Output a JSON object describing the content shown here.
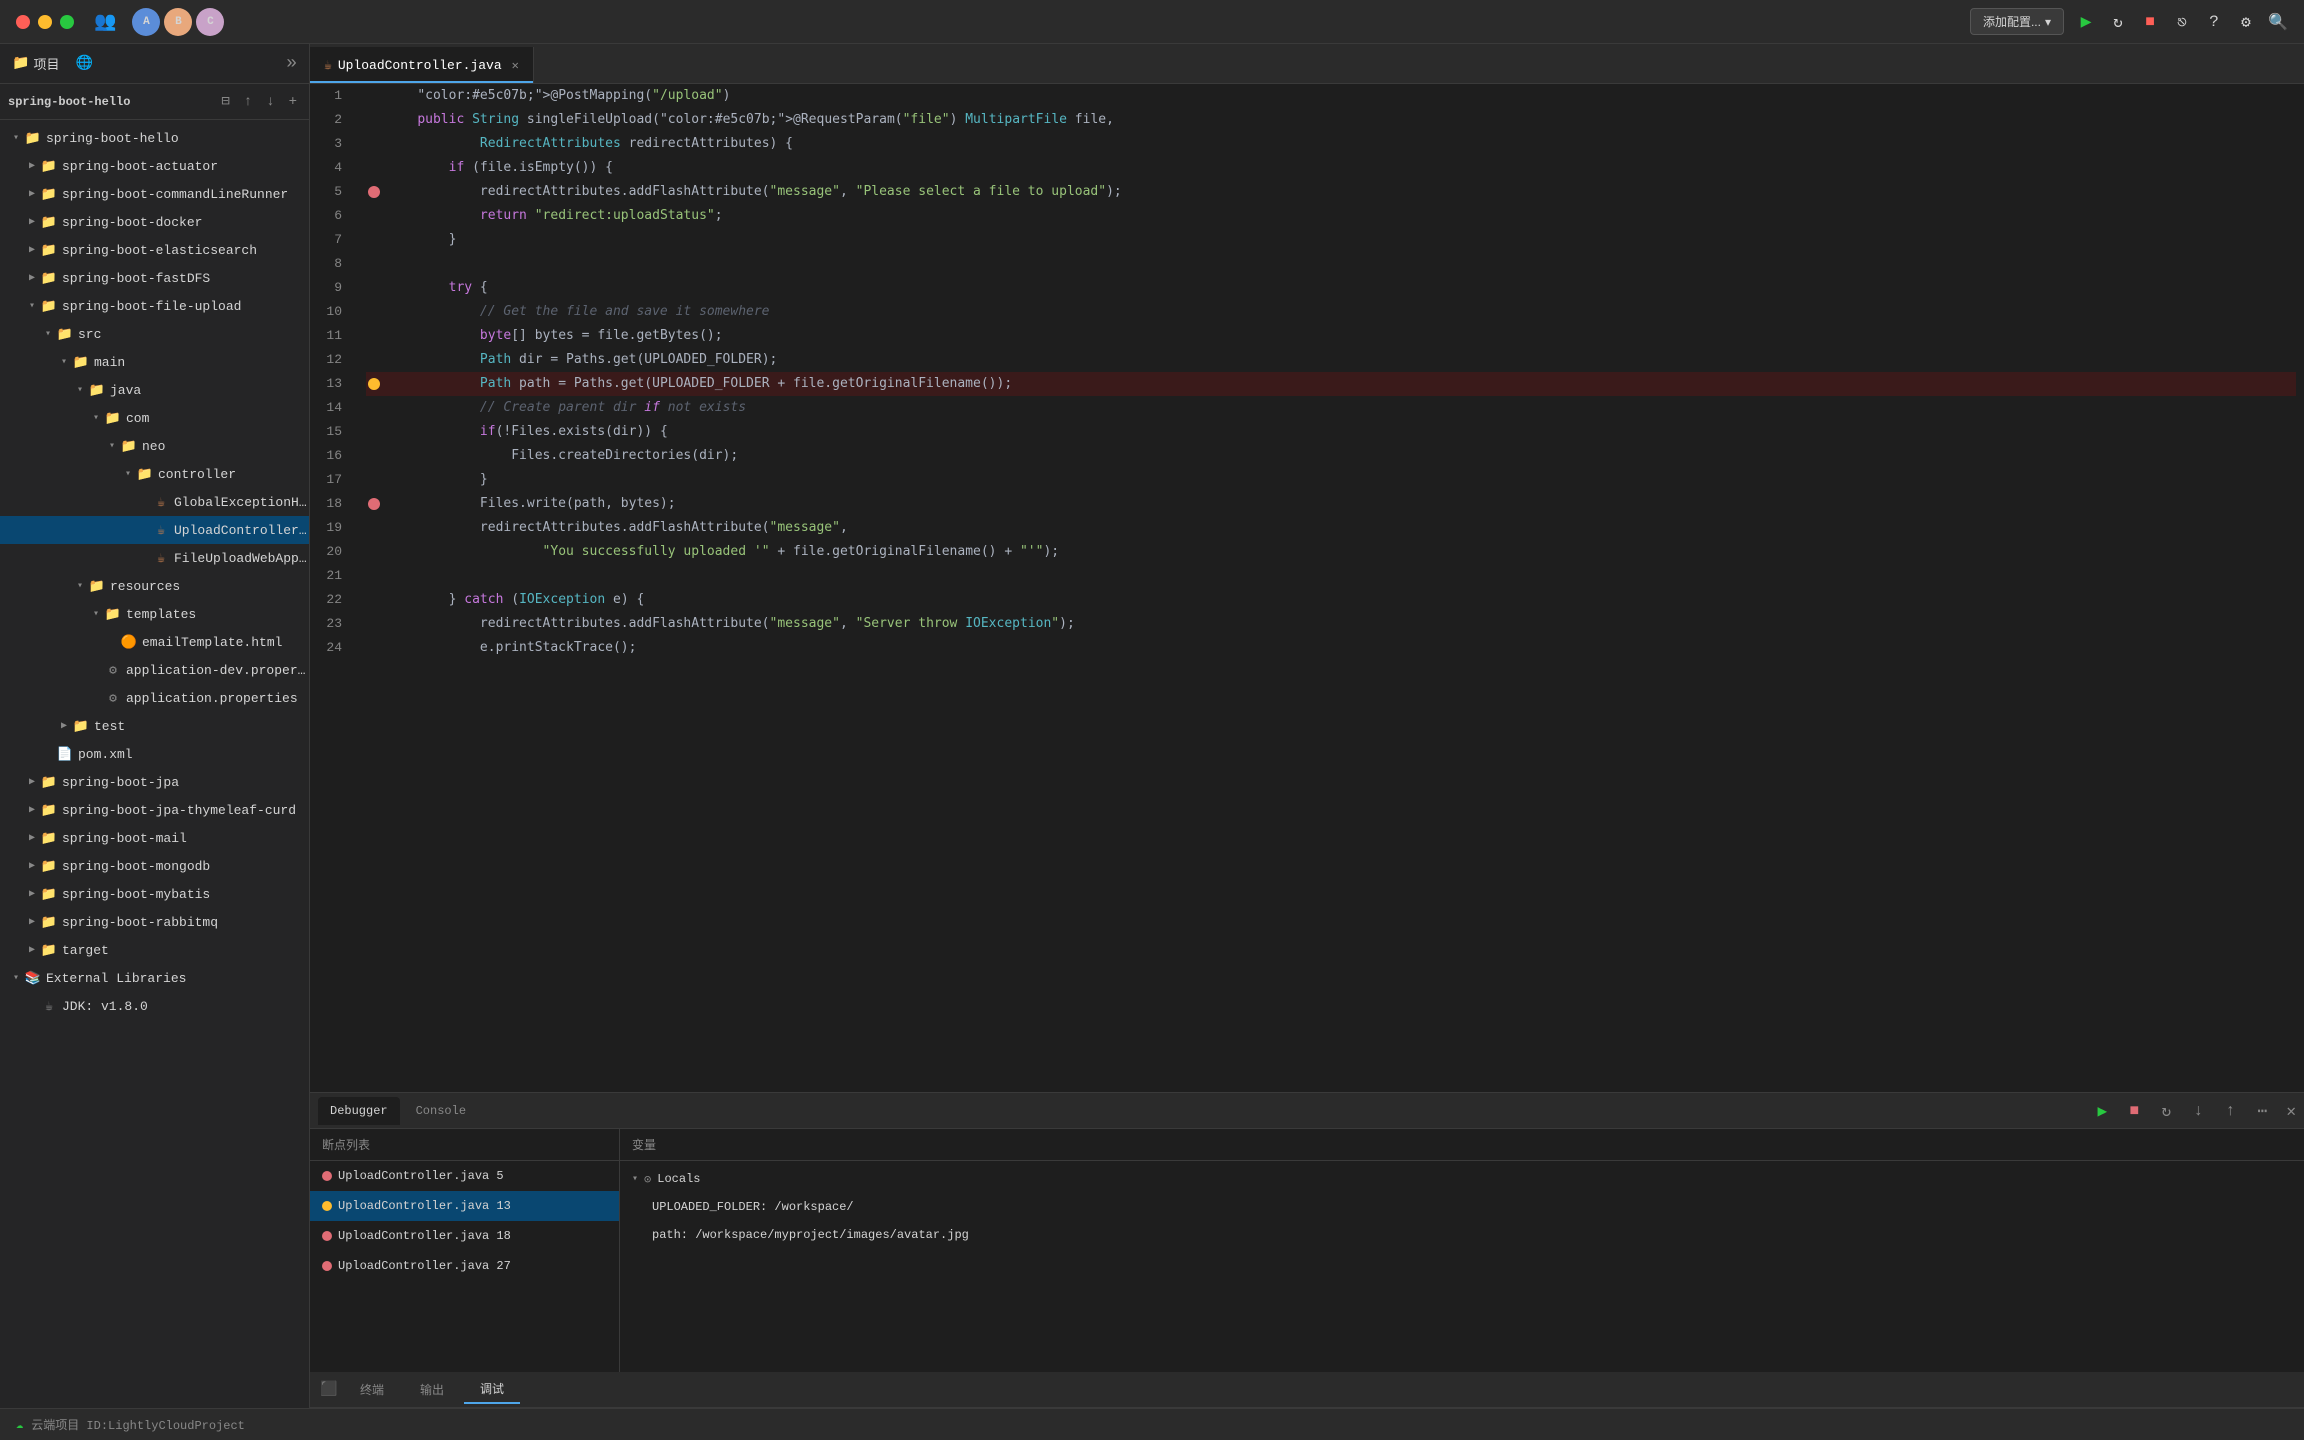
{
  "titlebar": {
    "add_config_label": "添加配置...",
    "chevron": "▾"
  },
  "sidebar": {
    "tabs": [
      {
        "label": "项目",
        "icon": "📁"
      },
      {
        "label": "🌐",
        "icon": "🌐"
      }
    ],
    "root": "spring-boot-hello",
    "tree": [
      {
        "id": "spring-boot-hello",
        "label": "spring-boot-hello",
        "indent": 8,
        "type": "root",
        "expanded": true,
        "arrow": "▾"
      },
      {
        "id": "spring-boot-actuator",
        "label": "spring-boot-actuator",
        "indent": 24,
        "type": "folder",
        "expanded": false,
        "arrow": "▶"
      },
      {
        "id": "spring-boot-commandLineRunner",
        "label": "spring-boot-commandLineRunner",
        "indent": 24,
        "type": "folder",
        "expanded": false,
        "arrow": "▶"
      },
      {
        "id": "spring-boot-docker",
        "label": "spring-boot-docker",
        "indent": 24,
        "type": "folder",
        "expanded": false,
        "arrow": "▶"
      },
      {
        "id": "spring-boot-elasticsearch",
        "label": "spring-boot-elasticsearch",
        "indent": 24,
        "type": "folder",
        "expanded": false,
        "arrow": "▶"
      },
      {
        "id": "spring-boot-fastDFS",
        "label": "spring-boot-fastDFS",
        "indent": 24,
        "type": "folder",
        "expanded": false,
        "arrow": "▶"
      },
      {
        "id": "spring-boot-file-upload",
        "label": "spring-boot-file-upload",
        "indent": 24,
        "type": "folder",
        "expanded": true,
        "arrow": "▾"
      },
      {
        "id": "src",
        "label": "src",
        "indent": 40,
        "type": "folder",
        "expanded": true,
        "arrow": "▾"
      },
      {
        "id": "main",
        "label": "main",
        "indent": 56,
        "type": "folder",
        "expanded": true,
        "arrow": "▾"
      },
      {
        "id": "java",
        "label": "java",
        "indent": 72,
        "type": "folder",
        "expanded": true,
        "arrow": "▾"
      },
      {
        "id": "com",
        "label": "com",
        "indent": 88,
        "type": "folder",
        "expanded": true,
        "arrow": "▾"
      },
      {
        "id": "neo",
        "label": "neo",
        "indent": 104,
        "type": "folder",
        "expanded": true,
        "arrow": "▾"
      },
      {
        "id": "controller",
        "label": "controller",
        "indent": 120,
        "type": "folder",
        "expanded": true,
        "arrow": "▾"
      },
      {
        "id": "GlobalExceptionHandler",
        "label": "GlobalExceptionHandler.ja...",
        "indent": 136,
        "type": "java",
        "expanded": false,
        "arrow": ""
      },
      {
        "id": "UploadController",
        "label": "UploadController.java",
        "indent": 136,
        "type": "java",
        "expanded": false,
        "arrow": "",
        "selected": true
      },
      {
        "id": "FileUploadWebApplication",
        "label": "FileUploadWebApplication.ja...",
        "indent": 136,
        "type": "java",
        "expanded": false,
        "arrow": ""
      },
      {
        "id": "resources",
        "label": "resources",
        "indent": 72,
        "type": "folder",
        "expanded": true,
        "arrow": "▾"
      },
      {
        "id": "templates",
        "label": "templates",
        "indent": 88,
        "type": "folder",
        "expanded": true,
        "arrow": "▾"
      },
      {
        "id": "emailTemplate",
        "label": "emailTemplate.html",
        "indent": 104,
        "type": "html",
        "expanded": false,
        "arrow": ""
      },
      {
        "id": "app-dev-props",
        "label": "application-dev.properties",
        "indent": 88,
        "type": "properties",
        "expanded": false,
        "arrow": ""
      },
      {
        "id": "app-props",
        "label": "application.properties",
        "indent": 88,
        "type": "properties",
        "expanded": false,
        "arrow": ""
      },
      {
        "id": "test",
        "label": "test",
        "indent": 56,
        "type": "folder",
        "expanded": false,
        "arrow": "▶"
      },
      {
        "id": "pom",
        "label": "pom.xml",
        "indent": 40,
        "type": "xml",
        "expanded": false,
        "arrow": ""
      },
      {
        "id": "spring-boot-jpa",
        "label": "spring-boot-jpa",
        "indent": 24,
        "type": "folder",
        "expanded": false,
        "arrow": "▶"
      },
      {
        "id": "spring-boot-jpa-thymeleaf-curd",
        "label": "spring-boot-jpa-thymeleaf-curd",
        "indent": 24,
        "type": "folder",
        "expanded": false,
        "arrow": "▶"
      },
      {
        "id": "spring-boot-mail",
        "label": "spring-boot-mail",
        "indent": 24,
        "type": "folder",
        "expanded": false,
        "arrow": "▶"
      },
      {
        "id": "spring-boot-mongodb",
        "label": "spring-boot-mongodb",
        "indent": 24,
        "type": "folder",
        "expanded": false,
        "arrow": "▶"
      },
      {
        "id": "spring-boot-mybatis",
        "label": "spring-boot-mybatis",
        "indent": 24,
        "type": "folder",
        "expanded": false,
        "arrow": "▶"
      },
      {
        "id": "spring-boot-rabbitmq",
        "label": "spring-boot-rabbitmq",
        "indent": 24,
        "type": "folder",
        "expanded": false,
        "arrow": "▶"
      },
      {
        "id": "target",
        "label": "target",
        "indent": 24,
        "type": "folder",
        "expanded": false,
        "arrow": "▶"
      },
      {
        "id": "external-libs",
        "label": "External Libraries",
        "indent": 8,
        "type": "ext",
        "expanded": true,
        "arrow": "▾"
      },
      {
        "id": "jdk",
        "label": "JDK: v1.8.0",
        "indent": 24,
        "type": "jdk",
        "expanded": false,
        "arrow": ""
      }
    ]
  },
  "editor": {
    "tab_label": "UploadController.java",
    "tab_icon": "☕",
    "lines": [
      {
        "n": 1,
        "code": "    @PostMapping(\"/upload\")",
        "bp": false,
        "hl": false
      },
      {
        "n": 2,
        "code": "    public String singleFileUpload(@RequestParam(\"file\") MultipartFile file,",
        "bp": false,
        "hl": false
      },
      {
        "n": 3,
        "code": "            RedirectAttributes redirectAttributes) {",
        "bp": false,
        "hl": false
      },
      {
        "n": 4,
        "code": "        if (file.isEmpty()) {",
        "bp": false,
        "hl": false
      },
      {
        "n": 5,
        "code": "            redirectAttributes.addFlashAttribute(\"message\", \"Please select a file to upload\");",
        "bp": true,
        "hl": false
      },
      {
        "n": 6,
        "code": "            return \"redirect:uploadStatus\";",
        "bp": false,
        "hl": false
      },
      {
        "n": 7,
        "code": "        }",
        "bp": false,
        "hl": false
      },
      {
        "n": 8,
        "code": "",
        "bp": false,
        "hl": false
      },
      {
        "n": 9,
        "code": "        try {",
        "bp": false,
        "hl": false
      },
      {
        "n": 10,
        "code": "            // Get the file and save it somewhere",
        "bp": false,
        "hl": false
      },
      {
        "n": 11,
        "code": "            byte[] bytes = file.getBytes();",
        "bp": false,
        "hl": false
      },
      {
        "n": 12,
        "code": "            Path dir = Paths.get(UPLOADED_FOLDER);",
        "bp": false,
        "hl": false
      },
      {
        "n": 13,
        "code": "            Path path = Paths.get(UPLOADED_FOLDER + file.getOriginalFilename());",
        "bp": true,
        "hl": true,
        "current": true
      },
      {
        "n": 14,
        "code": "            // Create parent dir if not exists",
        "bp": false,
        "hl": false
      },
      {
        "n": 15,
        "code": "            if(!Files.exists(dir)) {",
        "bp": false,
        "hl": false
      },
      {
        "n": 16,
        "code": "                Files.createDirectories(dir);",
        "bp": false,
        "hl": false
      },
      {
        "n": 17,
        "code": "            }",
        "bp": false,
        "hl": false
      },
      {
        "n": 18,
        "code": "            Files.write(path, bytes);",
        "bp": true,
        "hl": false
      },
      {
        "n": 19,
        "code": "            redirectAttributes.addFlashAttribute(\"message\",",
        "bp": false,
        "hl": false
      },
      {
        "n": 20,
        "code": "                    \"You successfully uploaded '\" + file.getOriginalFilename() + \"'\");",
        "bp": false,
        "hl": false
      },
      {
        "n": 21,
        "code": "",
        "bp": false,
        "hl": false
      },
      {
        "n": 22,
        "code": "        } catch (IOException e) {",
        "bp": false,
        "hl": false
      },
      {
        "n": 23,
        "code": "            redirectAttributes.addFlashAttribute(\"message\", \"Server throw IOException\");",
        "bp": false,
        "hl": false
      },
      {
        "n": 24,
        "code": "            e.printStackTrace();",
        "bp": false,
        "hl": false
      }
    ]
  },
  "debug": {
    "tabs": [
      {
        "label": "Debugger",
        "active": true
      },
      {
        "label": "Console",
        "active": false
      }
    ],
    "breakpoints_header": "断点列表",
    "variables_header": "变量",
    "breakpoints": [
      {
        "label": "UploadController.java 5",
        "current": false,
        "selected": false
      },
      {
        "label": "UploadController.java 13",
        "current": true,
        "selected": true
      },
      {
        "label": "UploadController.java 18",
        "current": false,
        "selected": false
      },
      {
        "label": "UploadController.java 27",
        "current": false,
        "selected": false
      }
    ],
    "variables": [
      {
        "type": "section",
        "label": "Locals",
        "expanded": true
      },
      {
        "type": "var",
        "label": "UPLOADED_FOLDER: /workspace/"
      },
      {
        "type": "var",
        "label": "path: /workspace/myproject/images/avatar.jpg"
      }
    ]
  },
  "bottom_panel": {
    "tabs": [
      {
        "label": "终端",
        "active": false
      },
      {
        "label": "输出",
        "active": false
      },
      {
        "label": "调试",
        "active": true
      }
    ]
  },
  "bottom_bar": {
    "status": "云端项目 ID:LightlyCloudProject"
  }
}
